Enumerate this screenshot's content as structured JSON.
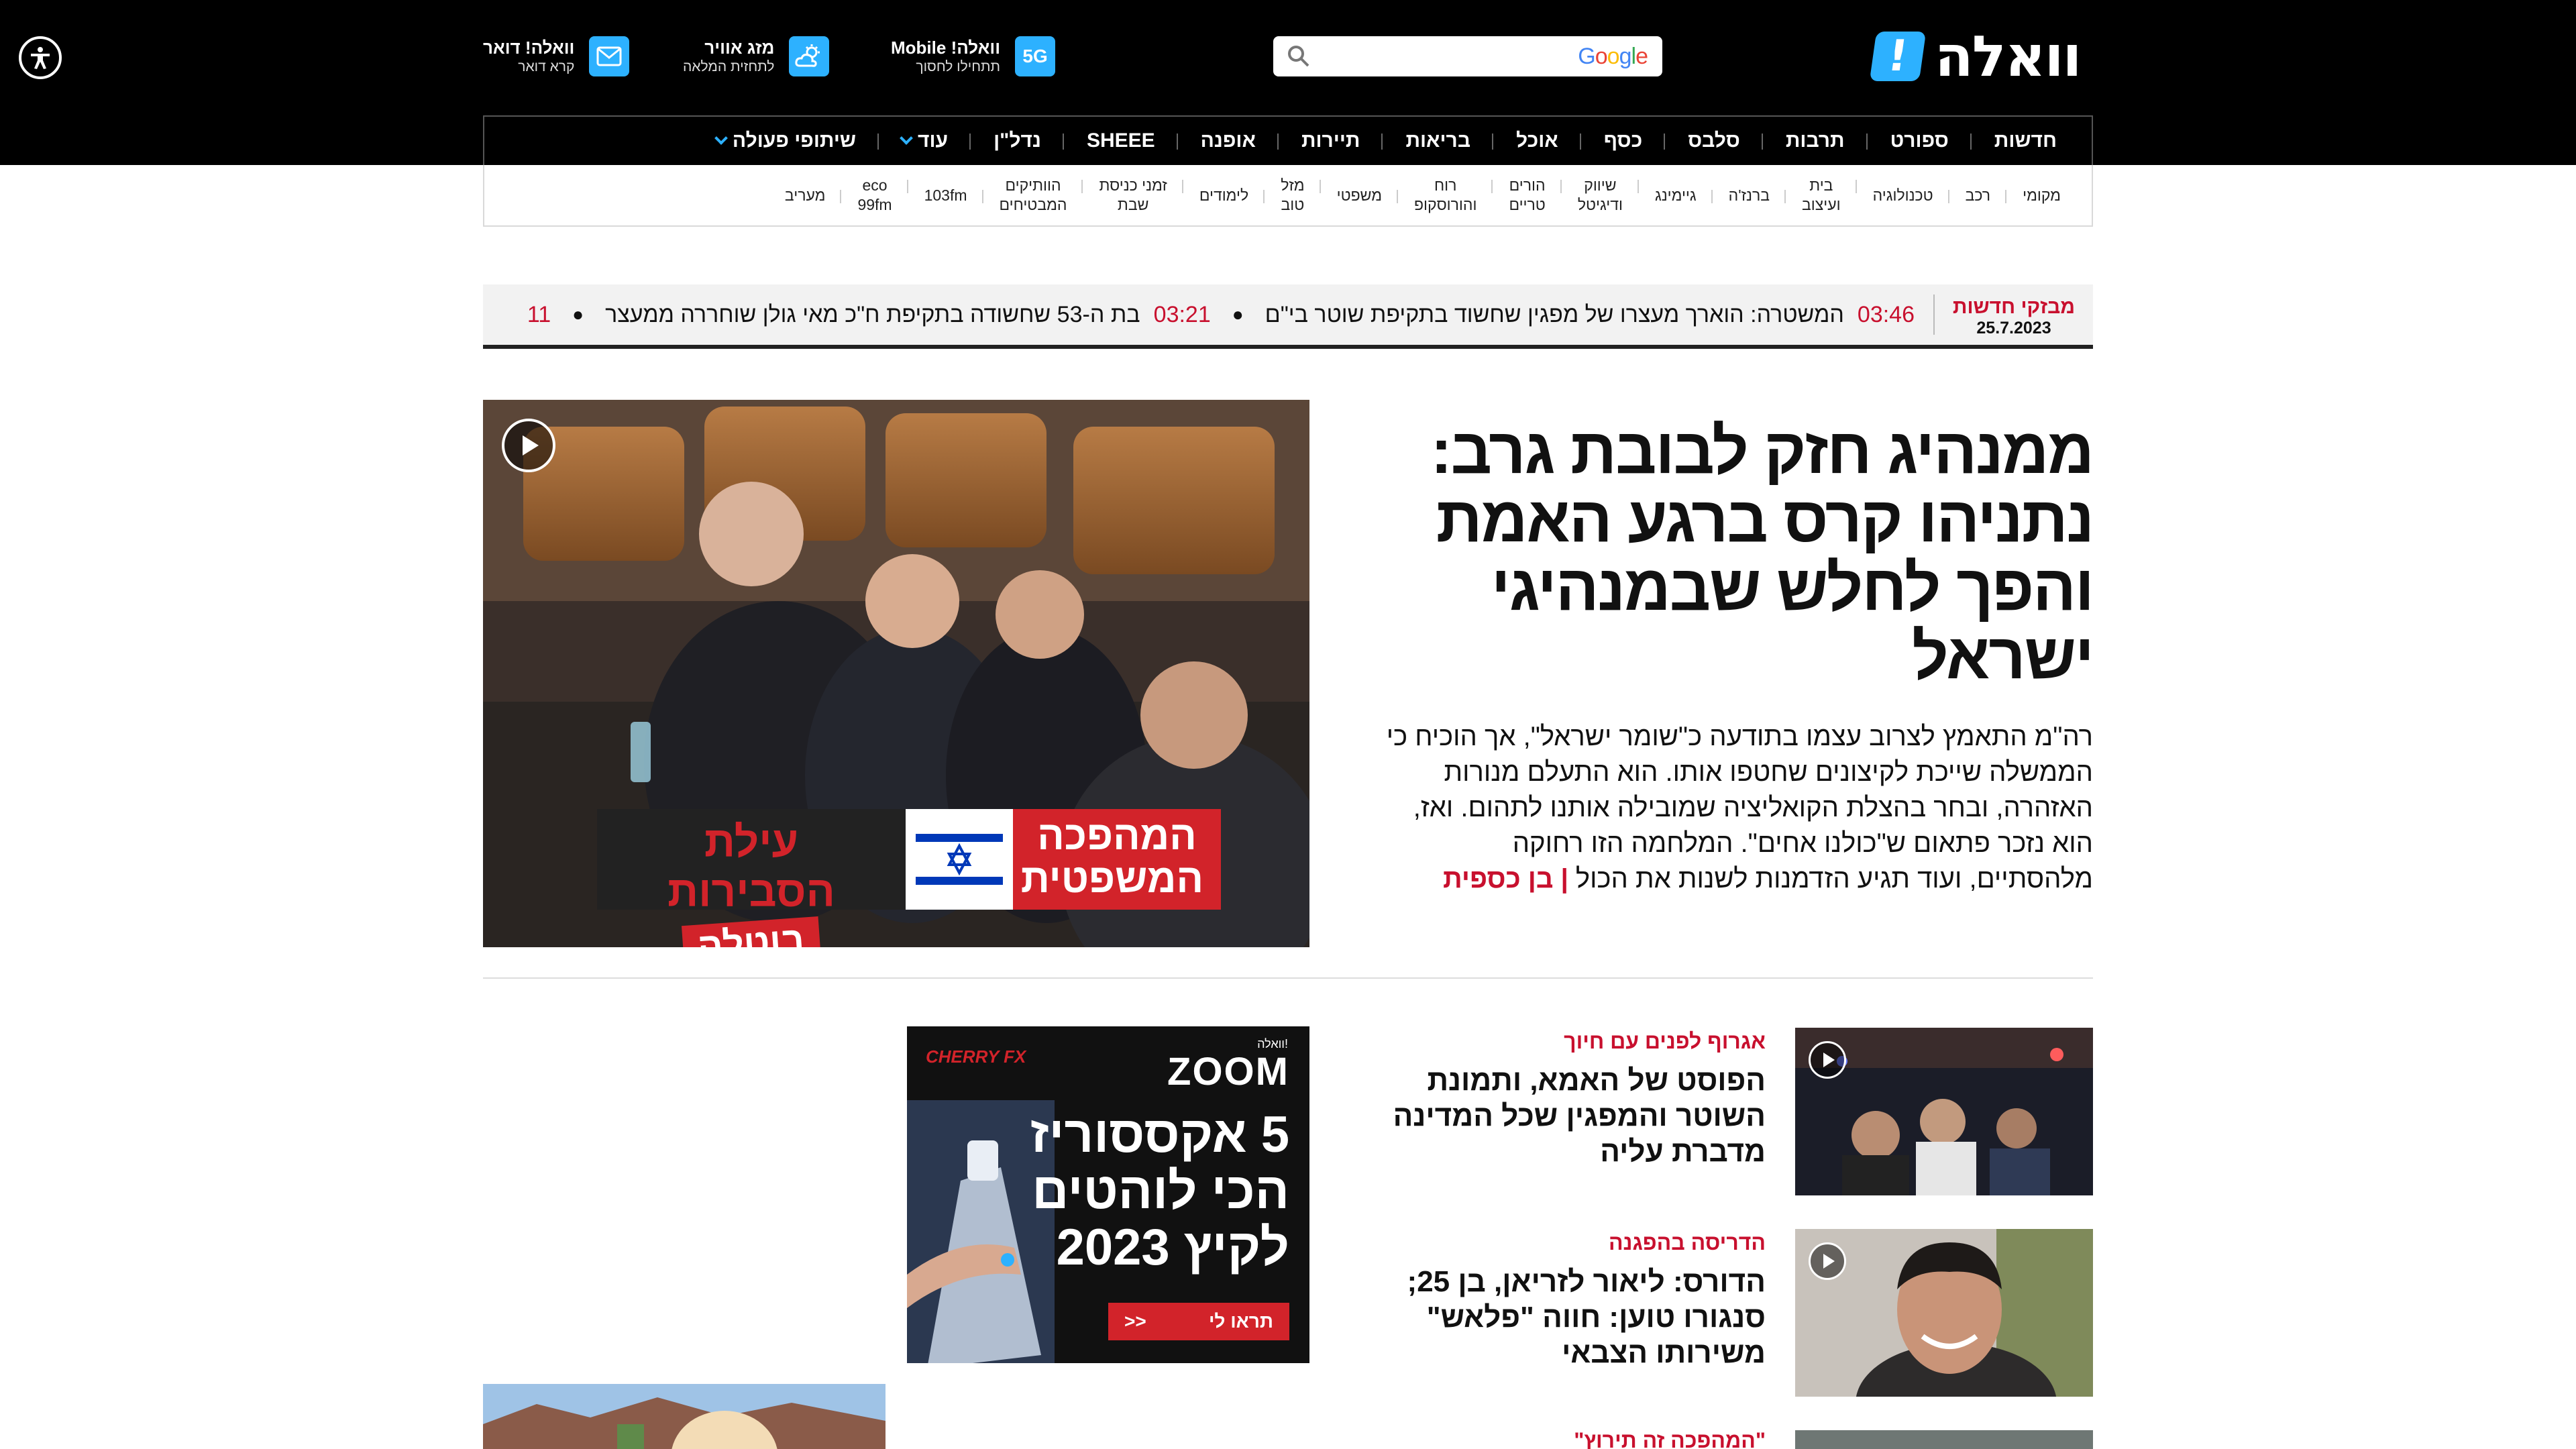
{
  "header": {
    "logo_mark": "!",
    "logo_text": "וואלה",
    "search": {
      "brand": "Google",
      "placeholder": ""
    },
    "utilities": [
      {
        "title": "וואלה! Mobile",
        "subtitle": "תתחילו לחסוך",
        "icon": "5G"
      },
      {
        "title": "מזג אוויר",
        "subtitle": "לתחזית המלאה",
        "icon": "weather-icon"
      },
      {
        "title": "וואלה! דואר",
        "subtitle": "קרא דואר",
        "icon": "mail-icon"
      }
    ]
  },
  "main_nav": [
    "חדשות",
    "ספורט",
    "תרבות",
    "סלבס",
    "כסף",
    "אוכל",
    "בריאות",
    "תיירות",
    "אופנה",
    "SHEEE",
    "נדל\"ן",
    "עוד",
    "שיתופי פעולה"
  ],
  "sub_nav": [
    "מקומי",
    "רכב",
    "טכנולוגיה",
    "בית\nועיצוב",
    "ברנז'ה",
    "גיימינג",
    "שיווק\nודיגיטל",
    "הורים\nטריים",
    "רוח\nוהורוסקופ",
    "משפטי",
    "מזל\nטוב",
    "לימודים",
    "זמני כניסת\nשבת",
    "הוותיקים\nהמבטיחים",
    "103fm",
    "eco\n99fm",
    "מעריב"
  ],
  "breaking": {
    "label": "מבזקי חדשות",
    "date": "25.7.2023",
    "items": [
      {
        "time": "03:46",
        "text": "המשטרה: הוארך מעצרו של מפגין שחשוד בתקיפת שוטר בי\"ם"
      },
      {
        "time": "03:21",
        "text": "בת ה-53 שחשודה בתקיפת ח\"כ מאי גולן שוחררה ממעצר"
      },
      {
        "time": "11",
        "text": ""
      }
    ]
  },
  "hero": {
    "title": "ממנהיג חזק לבובת גרב: נתניהו קרס ברגע האמת והפך לחלש שבמנהיגי ישראל",
    "summary": "רה\"מ התאמץ לצרוב עצמו בתודעה כ\"שומר ישראל\", אך הוכיח כי הממשלה שייכת לקיצונים שחטפו אותו. הוא התעלם מנורות האזהרה, ובחר בהצלת הקואליציה שמובילה אותנו לתהום. ואז, הוא נזכר פתאום ש\"כולנו אחים\". המלחמה הזו רחוקה מלהסתיים, ועוד תגיע הזדמנות לשנות את הכול",
    "author": "| בן כספית",
    "banner_left": "המהפכה המשפטית",
    "banner_right": "עילת הסבירות",
    "banner_stamp": "בוטלה"
  },
  "articles": [
    {
      "category": "אגרוף לפנים עם חיוך",
      "title": "הפוסט של האמא, ותמונת השוטר והמפגין שכל המדינה מדברת עליה"
    },
    {
      "category": "הדריסה בהפגנה",
      "title": "הדורס: ליאור לזריאן, בן 25; סנגורו טוען: חווה \"פלאש\" משירותו הצבאי"
    },
    {
      "category": "\"המהפכה זה תירוץ\"",
      "title": ""
    }
  ],
  "ad": {
    "brand": "CHERRY FX",
    "zoom_small": "וואלה!",
    "zoom": "ZOOM",
    "headline": "5 אקססוריז הכי לוהטים לקיץ 2023",
    "cta": "תראו לי",
    "cta_arrows": ">>"
  },
  "colors": {
    "accent": "#2db1ff",
    "brand_red": "#c8102e",
    "header_bg": "#000000"
  }
}
